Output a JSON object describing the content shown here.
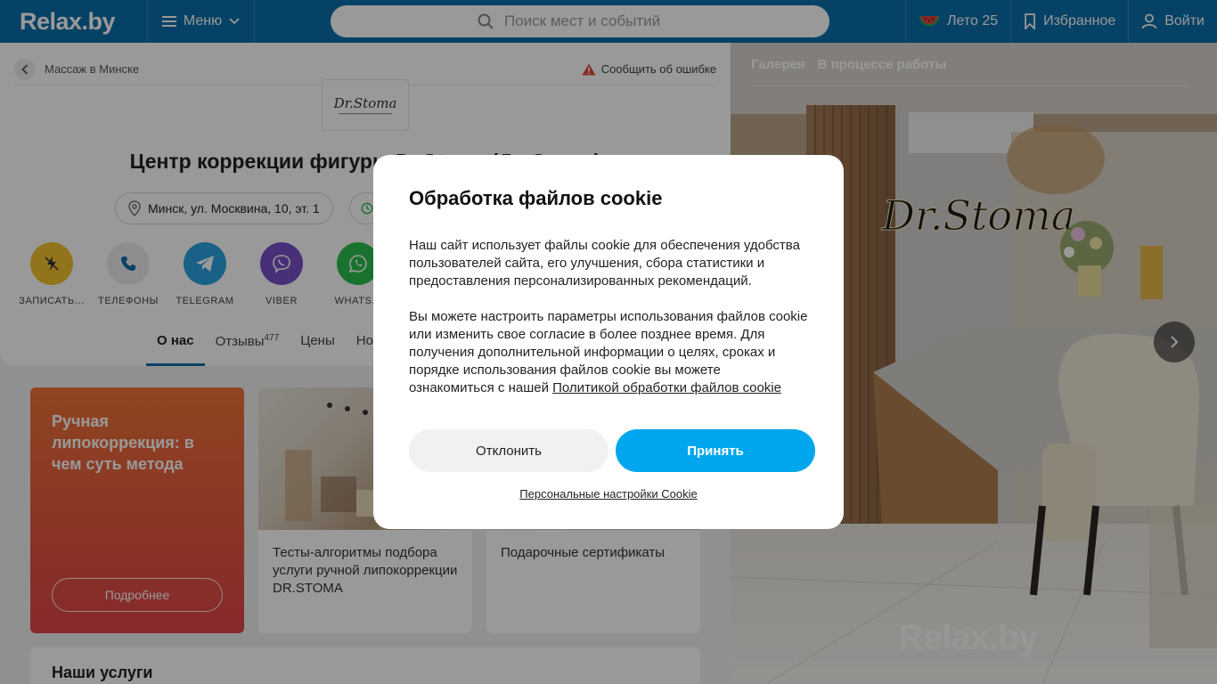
{
  "header": {
    "logo": "Relax.by",
    "menu_label": "Меню",
    "search_placeholder": "Поиск мест и событий",
    "summer_label": "Лето 25",
    "favorites_label": "Избранное",
    "login_label": "Войти"
  },
  "breadcrumb": {
    "label": "Массаж в Минске"
  },
  "report": {
    "label": "Сообщить об ошибке"
  },
  "brand_logo": {
    "text": "Dr.Stoma"
  },
  "org": {
    "title": "Центр коррекции фигуры Dr.Stoma (Др.Стома)",
    "address": "Минск, ул. Москвина, 10, эт. 1"
  },
  "actions": [
    {
      "label": "ЗАПИСАТЬ...",
      "color": "#f2c12e"
    },
    {
      "label": "ТЕЛЕФОНЫ",
      "color": "#ececec"
    },
    {
      "label": "TELEGRAM",
      "color": "#2aa2e0"
    },
    {
      "label": "VIBER",
      "color": "#7a4fc6"
    },
    {
      "label": "WHATS...",
      "color": "#2bc04f"
    }
  ],
  "tabs": [
    {
      "label": "О нас",
      "active": true
    },
    {
      "label": "Отзывы",
      "count": "477"
    },
    {
      "label": "Цены"
    },
    {
      "label": "Но"
    }
  ],
  "promo": {
    "title": "Ручная липокоррекция: в чем суть метода",
    "button": "Подробнее"
  },
  "cards": [
    {
      "text": "Тесты-алгоритмы подбора услуги ручной липокоррекции DR.STOMA"
    },
    {
      "text": "Подарочные сертификаты"
    }
  ],
  "services": {
    "title": "Наши услуги"
  },
  "gallery": {
    "tab1": "Галерея",
    "tab2": "В процессе работы",
    "sign_text": "Dr.Stoma",
    "watermark": "Relax.by"
  },
  "cookie_modal": {
    "title": "Обработка файлов cookie",
    "paragraph1": "Наш сайт использует файлы cookie для обеспечения удобства пользователей сайта, его улучшения, сбора статистики и предоставления персонализированных рекомендаций.",
    "paragraph2": "Вы можете настроить параметры использования файлов cookie или изменить свое согласие в более позднее время. Для получения дополнительной информации о целях, сроках и порядке использования файлов cookie вы можете ознакомиться с нашей",
    "policy_link": "Политикой обработки файлов cookie",
    "decline_label": "Отклонить",
    "accept_label": "Принять",
    "personal_settings_label": "Персональные настройки Cookie"
  }
}
